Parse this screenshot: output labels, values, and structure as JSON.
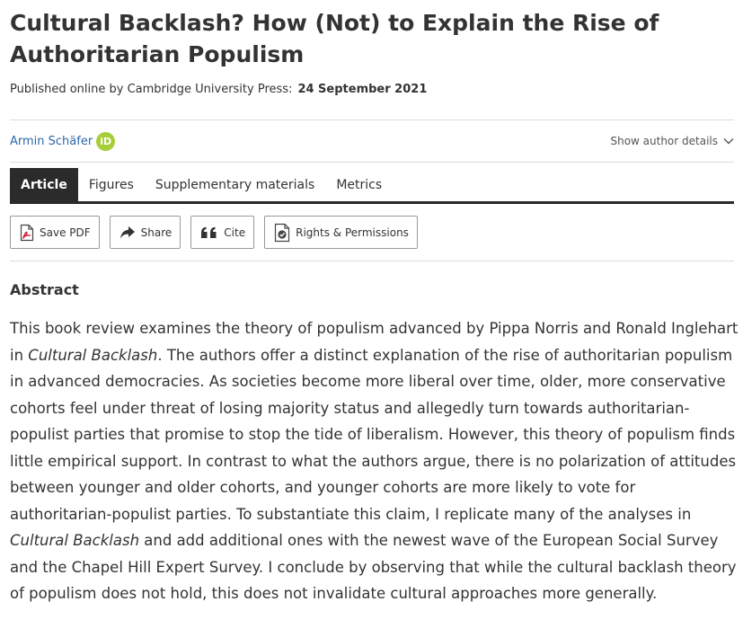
{
  "article": {
    "title": "Cultural Backlash? How (Not) to Explain the Rise of Authoritarian Populism",
    "published_label": "Published online by Cambridge University Press:",
    "published_date": "24 September 2021"
  },
  "author": {
    "name": "Armin Schäfer",
    "orcid_badge": "iD",
    "show_details_label": "Show author details"
  },
  "tabs": [
    {
      "label": "Article",
      "active": true
    },
    {
      "label": "Figures",
      "active": false
    },
    {
      "label": "Supplementary materials",
      "active": false
    },
    {
      "label": "Metrics",
      "active": false
    }
  ],
  "actions": {
    "save_pdf": "Save PDF",
    "share": "Share",
    "cite": "Cite",
    "rights": "Rights & Permissions"
  },
  "abstract": {
    "heading": "Abstract",
    "p1": "This book review examines the theory of populism advanced by Pippa Norris and Ronald Inglehart in ",
    "i1": "Cultural Backlash",
    "p2": ". The authors offer a distinct explanation of the rise of authoritarian populism in advanced democracies. As societies become more liberal over time, older, more conservative cohorts feel under threat of losing majority status and allegedly turn towards authoritarian-populist parties that promise to stop the tide of liberalism. However, this theory of populism finds little empirical support. In contrast to what the authors argue, there is no polarization of attitudes between younger and older cohorts, and younger cohorts are more likely to vote for authoritarian-populist parties. To substantiate this claim, I replicate many of the analyses in ",
    "i2": "Cultural Backlash",
    "p3": " and add additional ones with the newest wave of the European Social Survey and the Chapel Hill Expert Survey. I conclude by observing that while the cultural backlash theory of populism does not hold, this does not invalidate cultural approaches more generally."
  },
  "colors": {
    "author_link": "#2c67a8",
    "orcid_green": "#a6ce39",
    "tab_active_bg": "#2b2b2b",
    "pdf_red": "#c8102e"
  },
  "icons": {
    "save_pdf": "pdf-file-icon",
    "share": "share-arrow-icon",
    "cite": "quote-icon",
    "rights": "rights-document-icon",
    "show_details": "chevron-down-icon"
  }
}
